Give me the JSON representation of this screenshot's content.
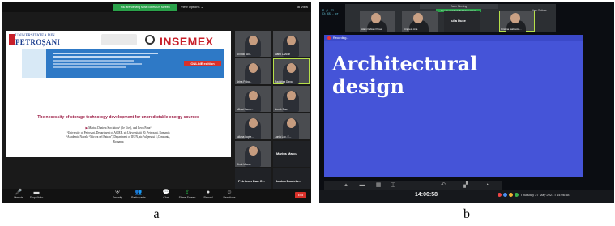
{
  "captions": {
    "a": "a",
    "b": "b"
  },
  "panel_a": {
    "top_banner": "You are viewing Mihai Ionescu's screen",
    "view_options": "View Options ⌄",
    "view_button": "⊞ View",
    "slide": {
      "logo_university_small": "UNIVERSITATEA DIN",
      "logo_university_name": "PETROȘANI",
      "logo_insemex": "INSEMEX",
      "online_badge": "ONLINE edition",
      "title": "The necessity of storage technology development for unpredictable energy sources",
      "authors": "Marius Daniela Stochitoiu¹ (lle Ute²), and Leon Pana²",
      "affiliation_1": "¹University of Petrosani, Department of ACIEE, str.Universitatii 20, Petrosani, Romania",
      "affiliation_2": "²Academia Navala “Mircea cel Batran”, Department of IEFN, str.Fulgerului 1,Constanta,",
      "affiliation_2b": "Romania"
    },
    "participants": [
      {
        "name": "Ali Hoc (Ali...",
        "type": "video"
      },
      {
        "name": "Mario Lazzari",
        "type": "video"
      },
      {
        "name": "Arina Paba...",
        "type": "video"
      },
      {
        "name": "Rachitisa Dana",
        "type": "video",
        "active": true
      },
      {
        "name": "Mihael Bann...",
        "type": "video"
      },
      {
        "name": "Noorb Dua",
        "type": "video"
      },
      {
        "name": "Iuliana Lapte...",
        "type": "video"
      },
      {
        "name": "Lonia Loc. E...",
        "type": "video"
      },
      {
        "name": "Dinut Ulianu",
        "type": "video"
      },
      {
        "name": "Marius Marcu",
        "type": "name"
      },
      {
        "name": "Petrilean Dan C...",
        "type": "name"
      },
      {
        "name": "Ionica Daniela...",
        "type": "name"
      },
      {
        "name": "Iulian Iliuti...",
        "type": "video"
      },
      {
        "name": "Lorena Brida",
        "type": "video"
      }
    ],
    "controls": [
      {
        "icon": "🎤",
        "label": "Unmute"
      },
      {
        "icon": "▬",
        "label": "Stop Video"
      },
      {
        "icon": "⛨",
        "label": "Security"
      },
      {
        "icon": "👥",
        "label": "Participants"
      },
      {
        "icon": "💬",
        "label": "Chat"
      },
      {
        "icon": "⇪",
        "label": "Share Screen",
        "accent": true
      },
      {
        "icon": "●",
        "label": "Record"
      },
      {
        "icon": "☺",
        "label": "Reactions"
      }
    ],
    "end_button": "End"
  },
  "panel_b": {
    "terminal_lines": [
      "$ j! 7?",
      "Ct X5 - cr"
    ],
    "meeting_title": "Zoom Meeting",
    "recording_banner": "You are viewing Iulia Duce's screen",
    "view_options": "View Options ⌄",
    "participants": [
      {
        "name": "Alain Fabian Paras",
        "type": "video"
      },
      {
        "name": "Cinpreta Ana",
        "type": "video"
      },
      {
        "name": "Iulia Duce",
        "type": "name"
      },
      {
        "name": "Cristina Sabinolia...",
        "type": "video",
        "active": true
      }
    ],
    "recording_label": "Recording...",
    "slide_title_line1": "Architectural",
    "slide_title_line2": "design",
    "clock": "14:06:58",
    "tray_text": "Thursday 27 May 2021 • 14:06:58",
    "colors": {
      "slide_bg": "#4554d8",
      "record_dot": "#e33333"
    }
  }
}
